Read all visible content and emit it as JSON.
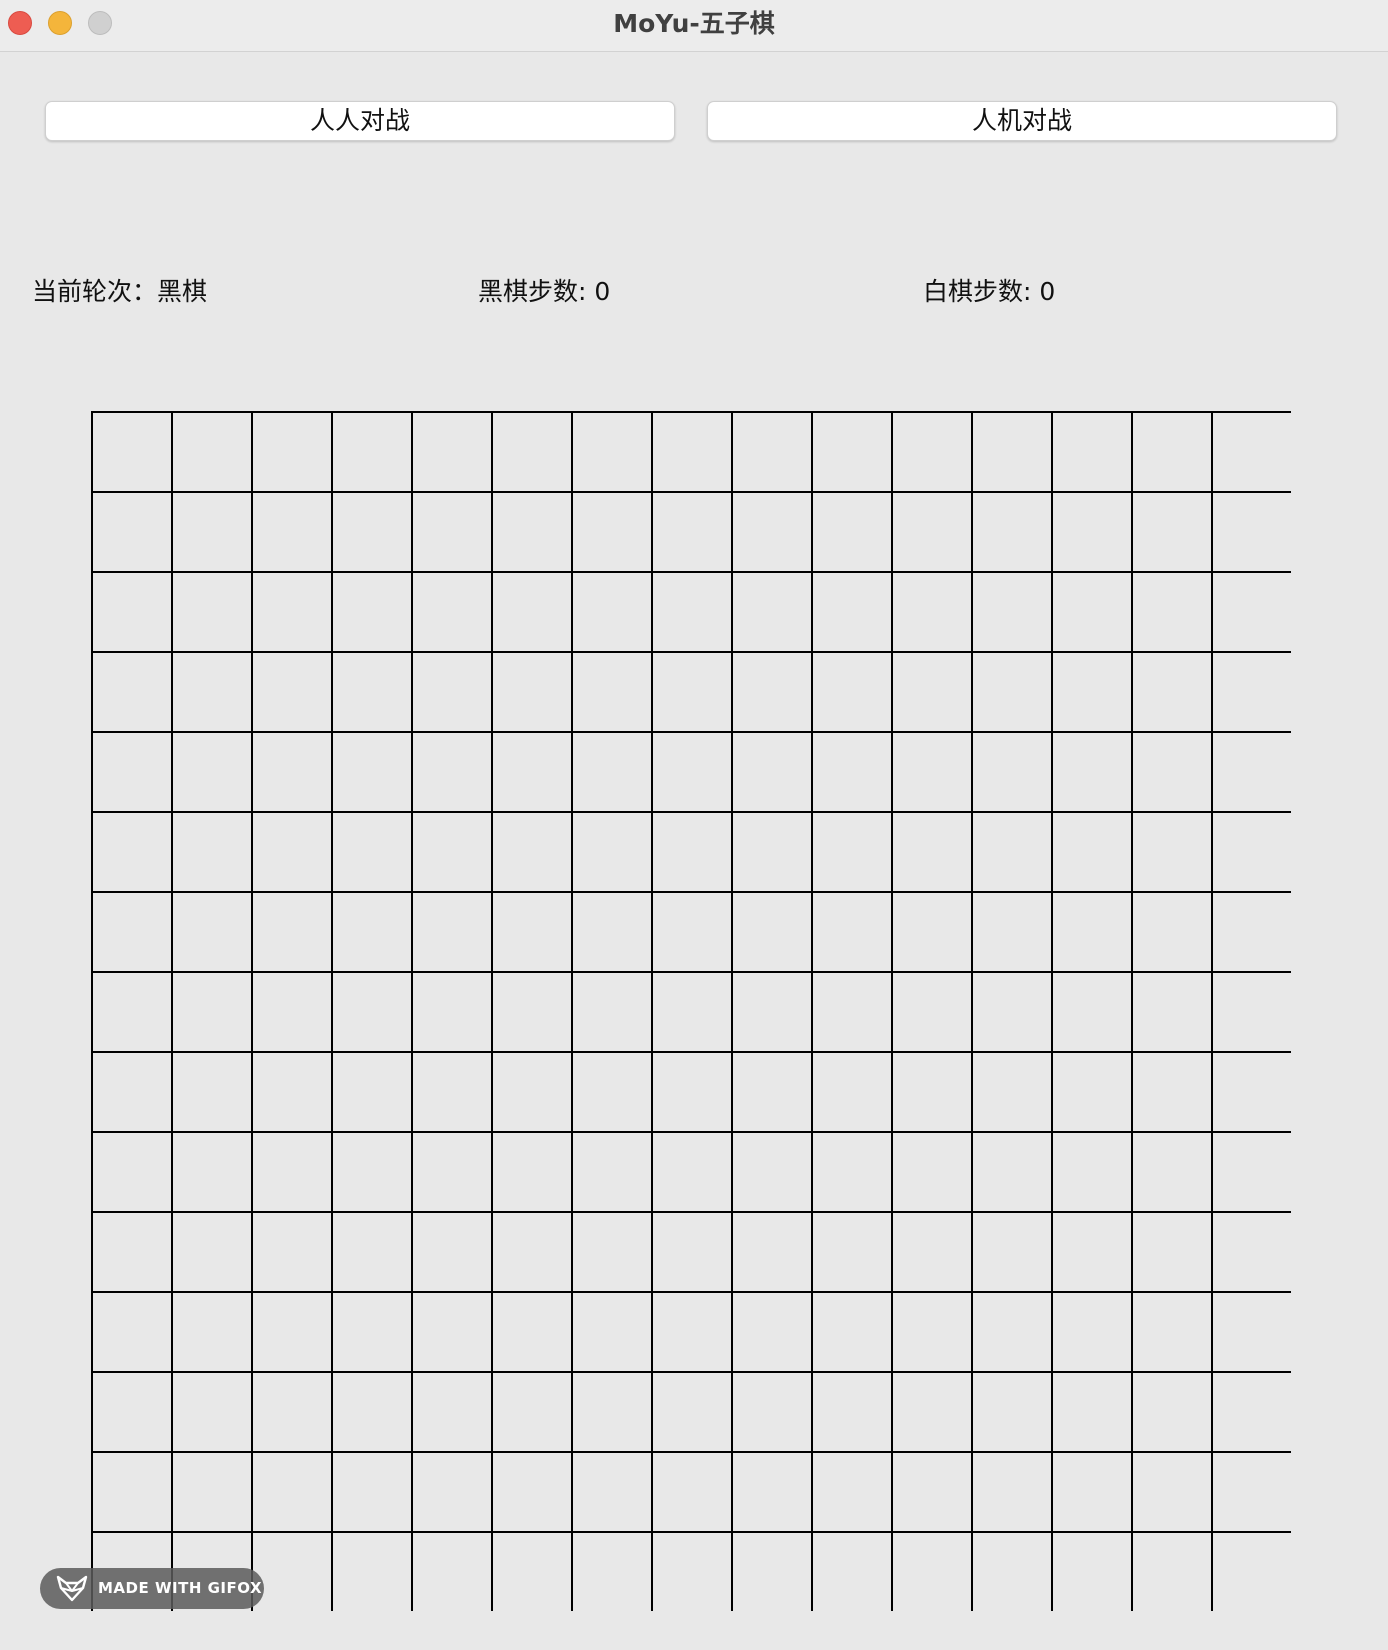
{
  "window": {
    "title": "MoYu-五子棋"
  },
  "modes": {
    "pvp_label": "人人对战",
    "pve_label": "人机对战"
  },
  "status": {
    "turn_label": "当前轮次：",
    "turn_value": "黑棋",
    "black_steps_label": "黑棋步数: ",
    "black_steps_value": "0",
    "white_steps_label": "白棋步数: ",
    "white_steps_value": "0"
  },
  "board": {
    "columns": 15,
    "rows": 15,
    "line_color": "#000000",
    "background": "#e8e8e8",
    "stones": []
  },
  "watermark": {
    "icon": "fox-icon",
    "text": "MADE WITH GIFOX"
  },
  "colors": {
    "close": "#ee5d52",
    "minimize": "#f4b53b",
    "maximize": "#d0d0d0"
  }
}
